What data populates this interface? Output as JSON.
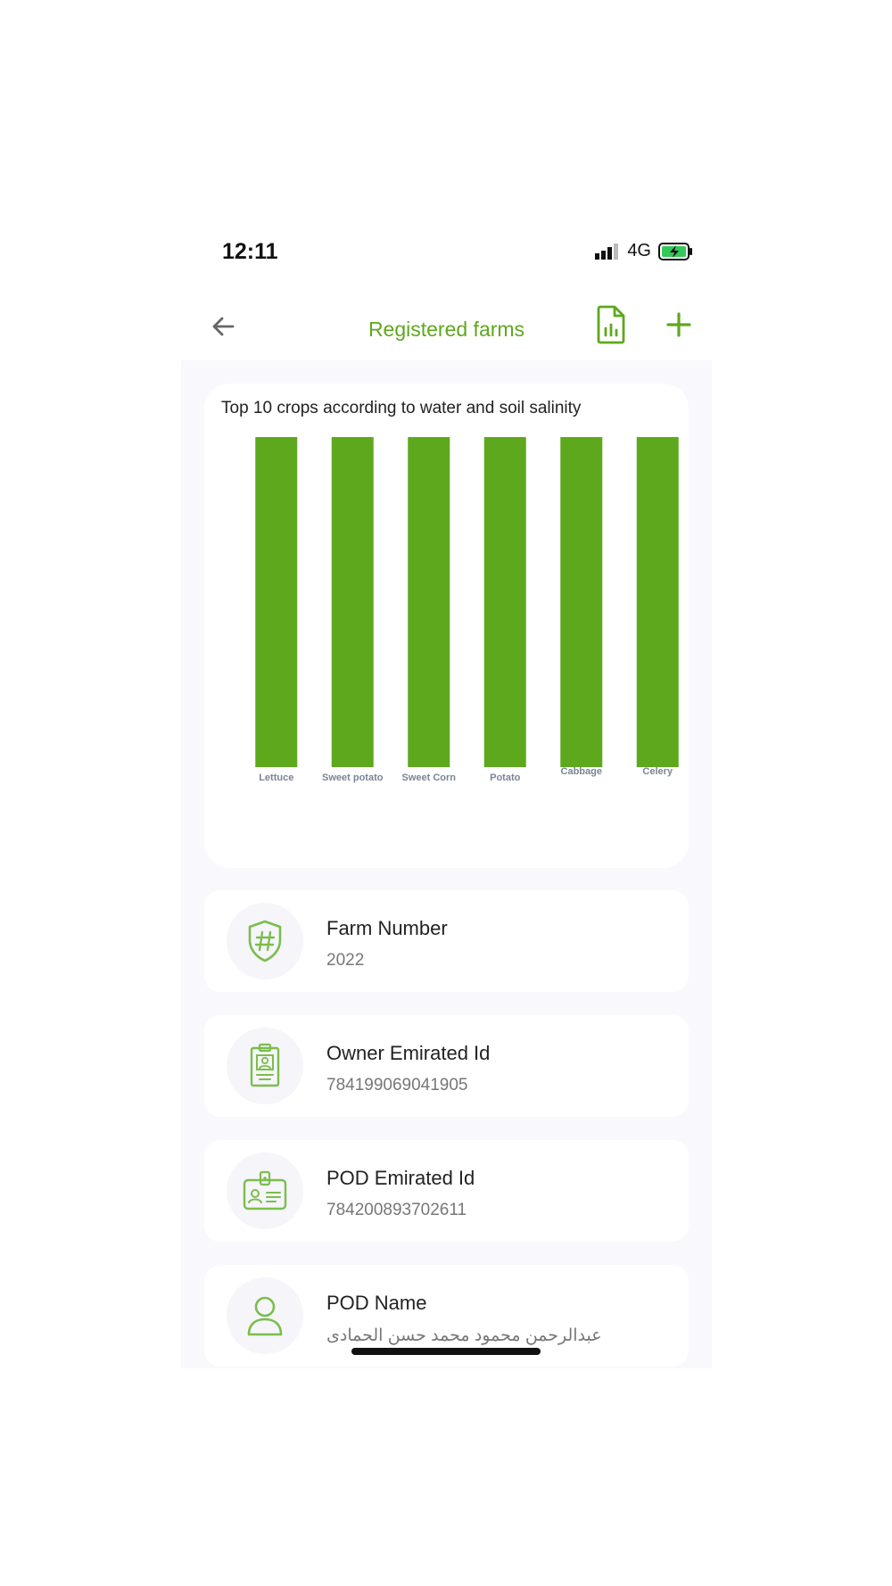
{
  "status_bar": {
    "time": "12:11",
    "network": "4G"
  },
  "header": {
    "title": "Registered farms"
  },
  "chart_data": {
    "type": "bar",
    "title": "Top 10 crops according to water and soil salinity",
    "categories": [
      "Lettuce",
      "Sweet potato",
      "Sweet Corn",
      "Potato",
      "Cabbage",
      "Celery"
    ],
    "values": [
      1,
      1,
      1,
      1,
      1,
      1
    ],
    "ylim": [
      0,
      1
    ],
    "bar_color": "#5ea81d",
    "grid": false,
    "legend": "none"
  },
  "details": [
    {
      "label": "Farm Number",
      "value": "2022",
      "icon": "shield-hash-icon"
    },
    {
      "label": "Owner Emirated Id",
      "value": "784199069041905",
      "icon": "id-badge-icon"
    },
    {
      "label": "POD Emirated Id",
      "value": "784200893702611",
      "icon": "id-card-icon"
    },
    {
      "label": "POD Name",
      "value": "عبدالرحمن محمود محمد حسن الحمادى",
      "icon": "user-icon"
    }
  ],
  "colors": {
    "accent": "#5ea81d",
    "icon_green": "#7cbd4c",
    "background": "#f8f8fd",
    "muted_text": "#777777"
  }
}
